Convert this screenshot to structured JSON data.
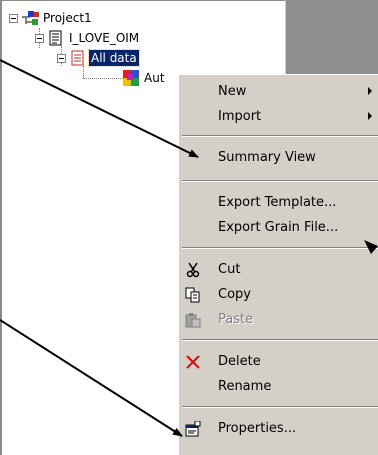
{
  "tree": {
    "project": "Project1",
    "dataset": "I_LOVE_OIM",
    "partition": "All data",
    "child": "Aut"
  },
  "menu": {
    "items": [
      {
        "label": "New",
        "submenu": true
      },
      {
        "label": "Import",
        "submenu": true
      },
      {
        "label": "Summary View"
      },
      {
        "label": "Export Template..."
      },
      {
        "label": "Export Grain File..."
      },
      {
        "label": "Cut",
        "icon": "scissors-icon"
      },
      {
        "label": "Copy",
        "icon": "copy-icon"
      },
      {
        "label": "Paste",
        "icon": "paste-icon",
        "disabled": true
      },
      {
        "label": "Delete",
        "icon": "delete-x-icon"
      },
      {
        "label": "Rename"
      },
      {
        "label": "Properties...",
        "icon": "properties-icon"
      }
    ]
  },
  "colors": {
    "selection": "#0a246a",
    "menu_bg": "#d4d0c8",
    "annotation_arrow": "#000000"
  }
}
